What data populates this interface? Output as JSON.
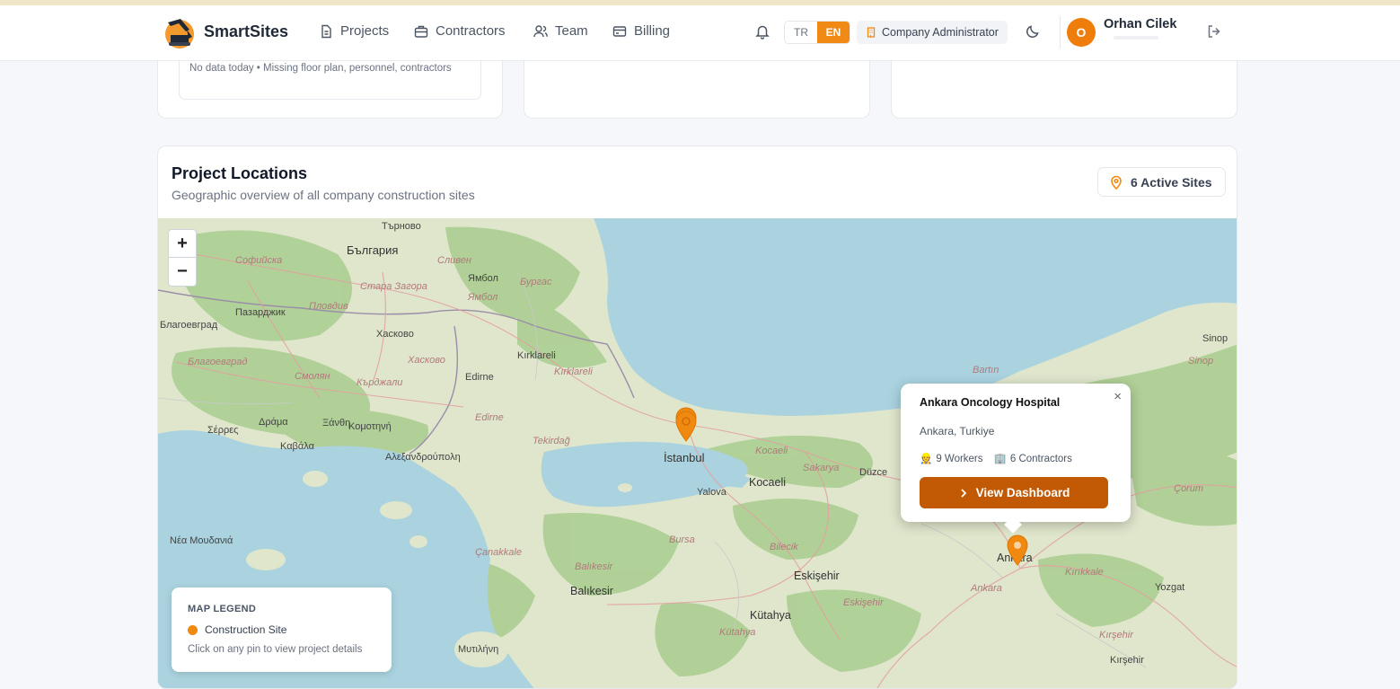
{
  "header": {
    "brand": "SmartSites",
    "nav": [
      {
        "label": "Projects",
        "icon": "document-icon"
      },
      {
        "label": "Contractors",
        "icon": "briefcase-icon"
      },
      {
        "label": "Team",
        "icon": "users-icon"
      },
      {
        "label": "Billing",
        "icon": "credit-card-icon"
      }
    ],
    "lang": {
      "tr": "TR",
      "en": "EN",
      "selected": "EN"
    },
    "role": "Company Administrator",
    "user": {
      "initial": "O",
      "name": "Orhan Cilek"
    }
  },
  "top_cards": {
    "nodata_text": "No data today • Missing floor plan, personnel, contractors"
  },
  "locations": {
    "title": "Project Locations",
    "subtitle": "Geographic overview of all company construction sites",
    "active_sites": "6 Active Sites",
    "zoom_in": "+",
    "zoom_out": "−",
    "map_labels": [
      "Търново",
      "България",
      "Софийска",
      "Сливен",
      "Ямбол",
      "Бургас",
      "Стара Загора",
      "Ямбол",
      "Пазарджик",
      "Пловдив",
      "Хасково",
      "Хасково",
      "Смолян",
      "Кърджали",
      "Kırklareli",
      "Kırklareli",
      "Edirne",
      "Edirne",
      "Δράμα",
      "Ξάνθη",
      "Κομοτηνή",
      "Σέρρες",
      "Καβάλα",
      "Αλεξανδρούπολη",
      "Tekirdağ",
      "İstanbul",
      "Kocaeli",
      "Kocaeli",
      "Sakarya",
      "Düzce",
      "Yalova",
      "Bursa",
      "Bilecik",
      "Eskişehir",
      "Eskişehir",
      "Çanakkale",
      "Balıkesir",
      "Balıkesir",
      "Kütahya",
      "Kütahya",
      "Ankara",
      "Ankara",
      "Kırıkkale",
      "Yozgat",
      "Kırşehir",
      "Kırşehir",
      "Çorum",
      "Bartın",
      "Sinop",
      "Sinop",
      "Νέα Μουδανιά",
      "Μυτιλήνη",
      "Благоевград",
      "Благоевград"
    ],
    "popup": {
      "title": "Ankara Oncology Hospital",
      "location": "Ankara, Turkiye",
      "workers": "9 Workers",
      "contractors": "6 Contractors",
      "button": "View Dashboard",
      "close": "×"
    },
    "legend": {
      "title": "MAP LEGEND",
      "item": "Construction Site",
      "note": "Click on any pin to view project details",
      "color": "#f0890f"
    }
  },
  "colors": {
    "accent": "#f08a15",
    "button": "#c25a05",
    "sea": "#a9d3de"
  }
}
